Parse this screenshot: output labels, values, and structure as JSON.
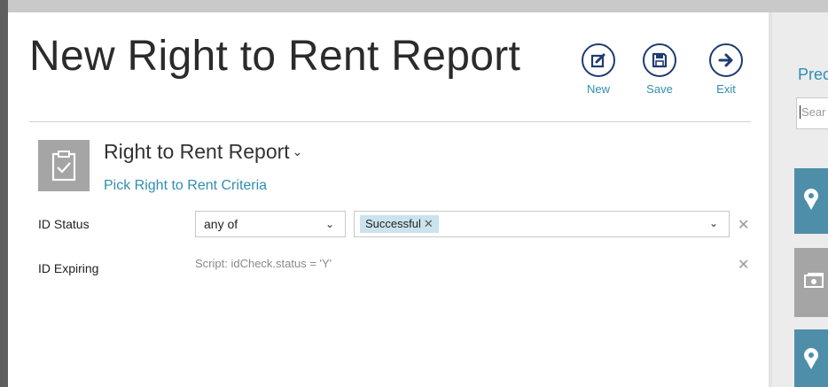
{
  "page": {
    "title": "New Right to Rent Report"
  },
  "toolbar": {
    "new_label": "New",
    "save_label": "Save",
    "exit_label": "Exit",
    "accent": "#1f3b73",
    "link_color": "#2f8fb3"
  },
  "report": {
    "name": "Right to Rent Report",
    "link": "Pick Right to Rent Criteria",
    "icon": "clipboard-check-icon"
  },
  "criteria": [
    {
      "label": "ID Status",
      "operator": "any of",
      "selected_values": [
        "Successful"
      ]
    },
    {
      "label": "ID Expiring",
      "script": "Script: idCheck.status = 'Y'"
    }
  ],
  "side_panel": {
    "title": "Prec",
    "search_text": "Sear",
    "tiles": [
      {
        "icon": "location-pin-icon",
        "color": "#4f8ea9"
      },
      {
        "icon": "money-icon",
        "color": "#a5a5a5"
      },
      {
        "icon": "location-pin-icon",
        "color": "#4f8ea9"
      }
    ]
  }
}
